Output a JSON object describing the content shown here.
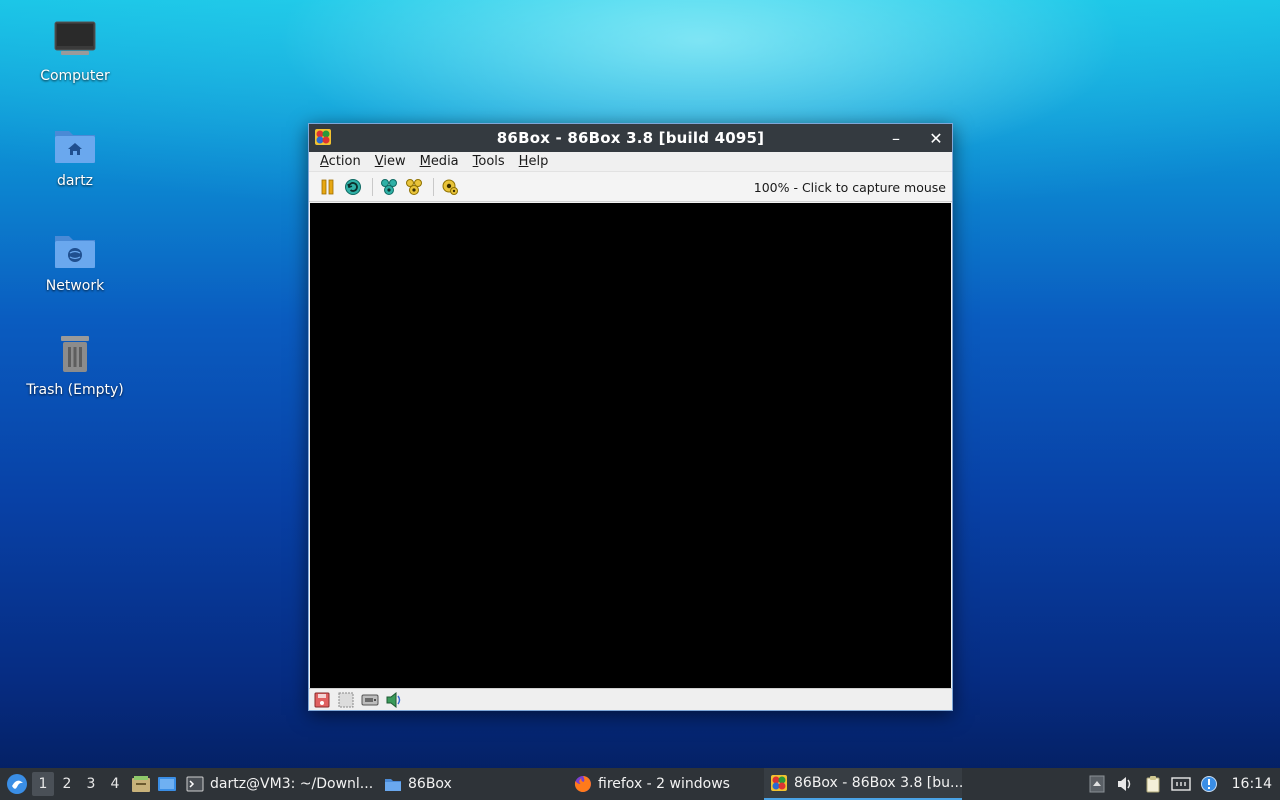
{
  "desktop": {
    "icons": [
      {
        "label": "Computer"
      },
      {
        "label": "dartz"
      },
      {
        "label": "Network"
      },
      {
        "label": "Trash (Empty)"
      }
    ]
  },
  "window": {
    "title": "86Box - 86Box 3.8 [build 4095]",
    "minimize_glyph": "–",
    "close_glyph": "✕",
    "menu": [
      {
        "ul": "A",
        "rest": "ction"
      },
      {
        "ul": "V",
        "rest": "iew"
      },
      {
        "ul": "M",
        "rest": "edia"
      },
      {
        "ul": "T",
        "rest": "ools"
      },
      {
        "ul": "H",
        "rest": "elp"
      }
    ],
    "toolbar": {
      "icons": [
        "pause-icon",
        "reset-icon",
        "ctrl-alt-del-icon",
        "ctrl-alt-esc-icon",
        "settings-icon"
      ],
      "status": "100% - Click to capture mouse"
    },
    "statusbar_icons": [
      "floppy-icon",
      "cdrom-icon",
      "hard-disk-icon",
      "sound-icon"
    ]
  },
  "taskbar": {
    "workspaces": [
      "1",
      "2",
      "3",
      "4"
    ],
    "active_workspace": "1",
    "tasks": [
      {
        "label": "dartz@VM3: ~/Downl...",
        "icon": "terminal-icon"
      },
      {
        "label": "86Box",
        "icon": "folder-icon"
      },
      {
        "label": "firefox - 2 windows",
        "icon": "firefox-icon"
      },
      {
        "label": "86Box - 86Box 3.8 [bu...",
        "icon": "86box-icon"
      }
    ],
    "clock": "16:14"
  },
  "colors": {
    "taskbar_bg": "#2e3338",
    "titlebar_bg": "#343a40",
    "accent": "#4aa3e6"
  }
}
